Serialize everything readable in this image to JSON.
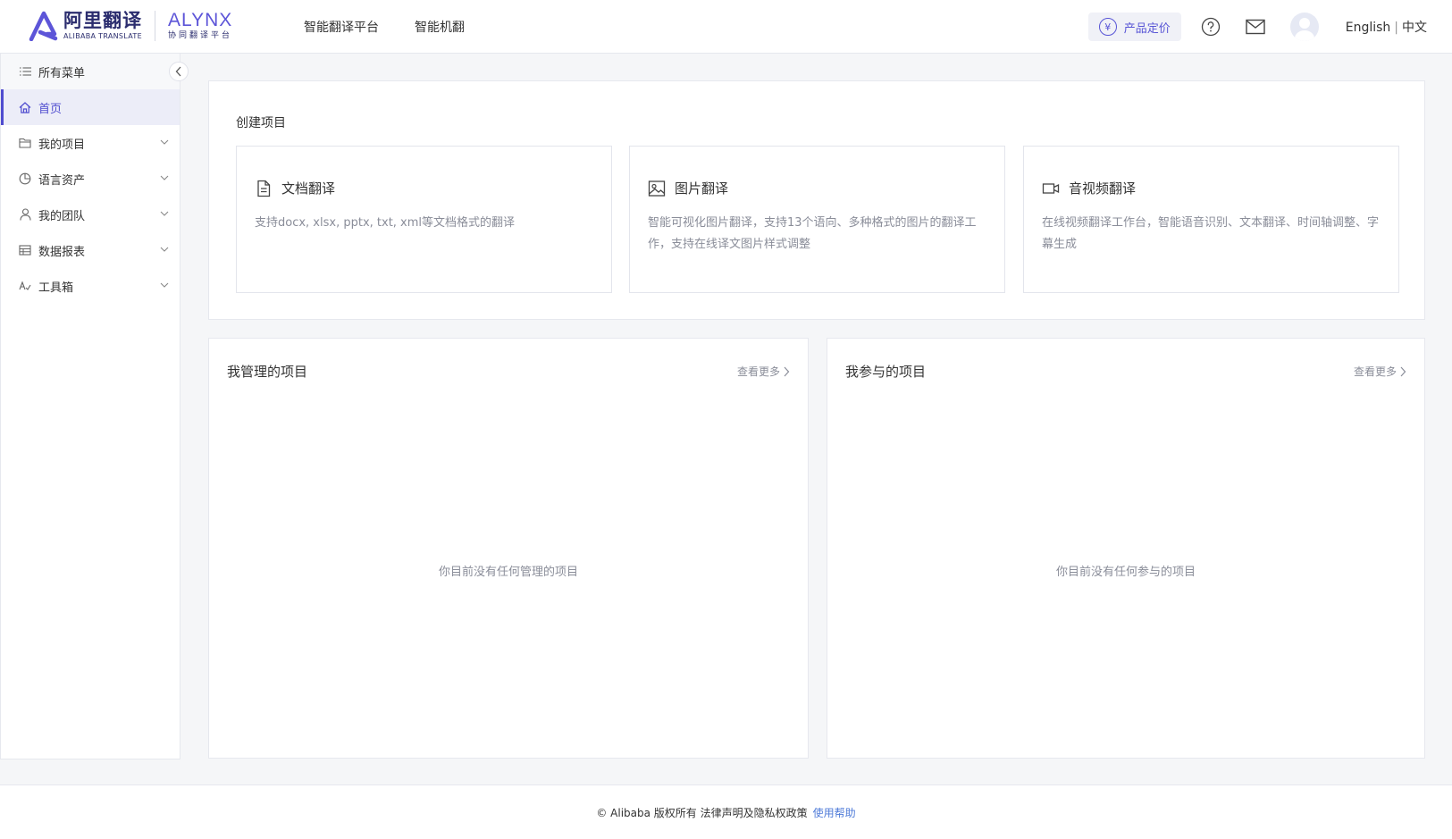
{
  "header": {
    "logo_cn": "阿里翻译",
    "logo_en": "ALIBABA TRANSLATE",
    "logo2_en": "ALYNX",
    "logo2_cn": "协同翻译平台",
    "nav": [
      "智能翻译平台",
      "智能机翻"
    ],
    "pricing_label": "产品定价",
    "lang_en": "English",
    "lang_sep": "|",
    "lang_cn": "中文"
  },
  "sidebar": {
    "all_menu": "所有菜单",
    "items": [
      {
        "label": "首页",
        "icon": "home-icon",
        "active": true
      },
      {
        "label": "我的项目",
        "icon": "folder-icon"
      },
      {
        "label": "语言资产",
        "icon": "pie-chart-icon"
      },
      {
        "label": "我的团队",
        "icon": "user-icon"
      },
      {
        "label": "数据报表",
        "icon": "table-icon"
      },
      {
        "label": "工具箱",
        "icon": "toolbox-icon"
      }
    ]
  },
  "create": {
    "title": "创建项目",
    "cards": [
      {
        "title": "文档翻译",
        "icon": "document-icon",
        "desc": "支持docx, xlsx, pptx, txt, xml等文档格式的翻译"
      },
      {
        "title": "图片翻译",
        "icon": "image-icon",
        "desc": "智能可视化图片翻译，支持13个语向、多种格式的图片的翻译工作，支持在线译文图片样式调整"
      },
      {
        "title": "音视频翻译",
        "icon": "video-icon",
        "desc": "在线视频翻译工作台，智能语音识别、文本翻译、时间轴调整、字幕生成"
      }
    ]
  },
  "managed": {
    "title": "我管理的项目",
    "more": "查看更多",
    "empty": "你目前没有任何管理的项目"
  },
  "joined": {
    "title": "我参与的项目",
    "more": "查看更多",
    "empty": "你目前没有任何参与的项目"
  },
  "footer": {
    "copyright": "© Alibaba 版权所有 法律声明及隐私权政策",
    "help": "使用帮助"
  },
  "colors": {
    "accent": "#4f4ccf",
    "brand_dark": "#2b2d6e",
    "muted": "#8a8d99",
    "link": "#4f7bd8"
  }
}
